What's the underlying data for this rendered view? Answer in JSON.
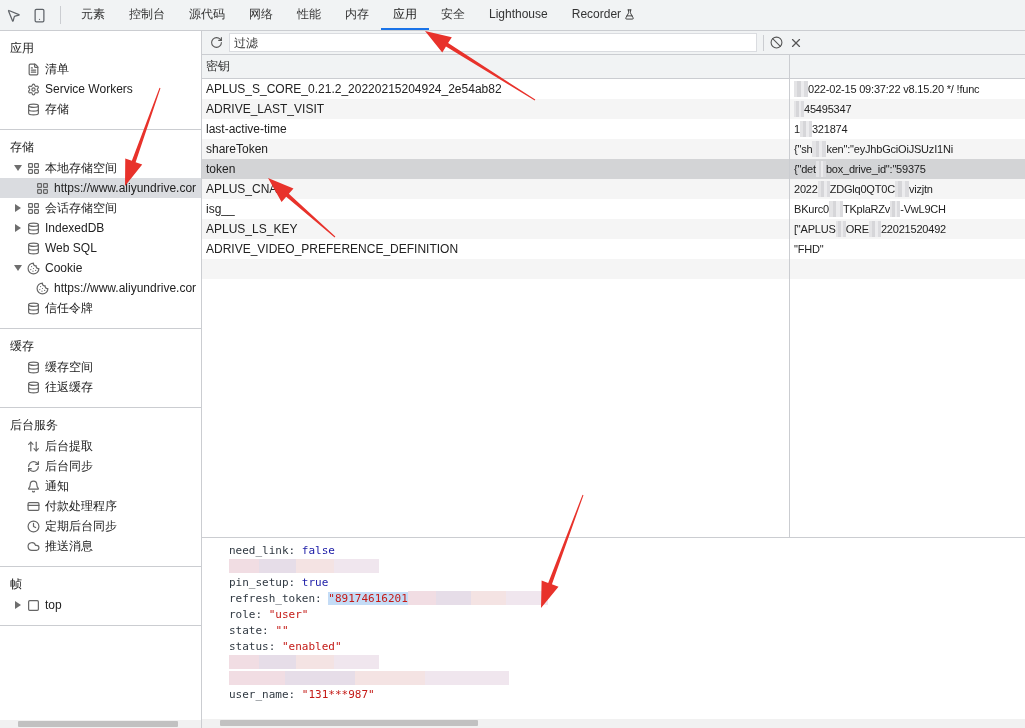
{
  "toolbar": {
    "tabs": [
      {
        "label": "元素",
        "selected": false
      },
      {
        "label": "控制台",
        "selected": false
      },
      {
        "label": "源代码",
        "selected": false
      },
      {
        "label": "网络",
        "selected": false
      },
      {
        "label": "性能",
        "selected": false
      },
      {
        "label": "内存",
        "selected": false
      },
      {
        "label": "应用",
        "selected": true
      },
      {
        "label": "安全",
        "selected": false
      },
      {
        "label": "Lighthouse",
        "selected": false
      },
      {
        "label": "Recorder",
        "selected": false,
        "kind": "experimental"
      }
    ]
  },
  "sidebar": {
    "sections": [
      {
        "title": "应用",
        "items": [
          {
            "kind": "file",
            "label": "清单"
          },
          {
            "kind": "gear",
            "label": "Service Workers"
          },
          {
            "kind": "database",
            "label": "存储"
          }
        ]
      },
      {
        "title": "存储",
        "items": [
          {
            "kind": "grid",
            "label": "本地存储空间",
            "expanded": true,
            "selected": false,
            "children": [
              {
                "kind": "grid",
                "label": "https://www.aliyundrive.cor",
                "selected": true
              }
            ]
          },
          {
            "kind": "grid",
            "label": "会话存储空间",
            "expanded": false,
            "selected": false
          },
          {
            "kind": "database",
            "label": "IndexedDB",
            "expanded": false,
            "selected": false
          },
          {
            "kind": "database",
            "label": "Web SQL"
          },
          {
            "kind": "cookie",
            "label": "Cookie",
            "expanded": true,
            "selected": false,
            "children": [
              {
                "kind": "cookie",
                "label": "https://www.aliyundrive.cor",
                "selected": false
              }
            ]
          },
          {
            "kind": "database",
            "label": "信任令牌"
          }
        ]
      },
      {
        "title": "缓存",
        "items": [
          {
            "kind": "database",
            "label": "缓存空间"
          },
          {
            "kind": "database",
            "label": "往返缓存"
          }
        ]
      },
      {
        "title": "后台服务",
        "items": [
          {
            "kind": "updown",
            "label": "后台提取"
          },
          {
            "kind": "sync",
            "label": "后台同步"
          },
          {
            "kind": "bell",
            "label": "通知"
          },
          {
            "kind": "card",
            "label": "付款处理程序"
          },
          {
            "kind": "clock",
            "label": "定期后台同步"
          },
          {
            "kind": "cloud",
            "label": "推送消息"
          }
        ]
      },
      {
        "title": "帧",
        "items": [
          {
            "kind": "frame",
            "label": "top",
            "expanded": false,
            "selected": false
          }
        ]
      }
    ]
  },
  "filter": {
    "placeholder": "过滤"
  },
  "table": {
    "columns": [
      "密钥"
    ],
    "rows": [
      {
        "key": "APLUS_S_CORE_0.21.2_20220215204924_2e54ab82",
        "selected": false,
        "value": [
          {
            "kind": "blur"
          },
          {
            "kind": "text",
            "text": "022-02-15 09:37:22 v8.15.20 */ !func"
          }
        ]
      },
      {
        "key": "ADRIVE_LAST_VISIT",
        "selected": false,
        "value": [
          {
            "kind": "blur"
          },
          {
            "kind": "text",
            "text": "45495347"
          }
        ]
      },
      {
        "key": "last-active-time",
        "selected": false,
        "value": [
          {
            "kind": "text",
            "text": "1"
          },
          {
            "kind": "blur"
          },
          {
            "kind": "text",
            "text": "321874"
          }
        ]
      },
      {
        "key": "shareToken",
        "selected": false,
        "value": [
          {
            "kind": "text",
            "text": "{\"sh"
          },
          {
            "kind": "blur"
          },
          {
            "kind": "text",
            "text": "ken\":\"eyJhbGciOiJSUzI1Ni"
          }
        ]
      },
      {
        "key": "token",
        "selected": true,
        "value": [
          {
            "kind": "text",
            "text": "{\"det"
          },
          {
            "kind": "blur"
          },
          {
            "kind": "text",
            "text": "box_drive_id\":\"59375"
          }
        ]
      },
      {
        "key": "APLUS_CNA",
        "selected": false,
        "value": [
          {
            "kind": "text",
            "text": "2022"
          },
          {
            "kind": "blur"
          },
          {
            "kind": "text",
            "text": "ZDGlq0QT0C"
          },
          {
            "kind": "blur"
          },
          {
            "kind": "text",
            "text": "vizjtn"
          }
        ]
      },
      {
        "key": "isg__",
        "selected": false,
        "value": [
          {
            "kind": "text",
            "text": "BKurc0"
          },
          {
            "kind": "blur"
          },
          {
            "kind": "text",
            "text": "TKplaRZv"
          },
          {
            "kind": "blur"
          },
          {
            "kind": "text",
            "text": "-VwL9CH"
          }
        ]
      },
      {
        "key": "APLUS_LS_KEY",
        "selected": false,
        "value": [
          {
            "kind": "text",
            "text": "[\"APLUS"
          },
          {
            "kind": "blur"
          },
          {
            "kind": "text",
            "text": "ORE"
          },
          {
            "kind": "blur"
          },
          {
            "kind": "text",
            "text": "22021520492"
          }
        ]
      },
      {
        "key": "ADRIVE_VIDEO_PREFERENCE_DEFINITION",
        "selected": false,
        "value": [
          {
            "kind": "text",
            "text": "\"FHD\""
          }
        ]
      }
    ]
  },
  "preview": {
    "lines": [
      {
        "kind": "field",
        "key": "need_link:",
        "value": "false",
        "string": false
      },
      {
        "kind": "blur"
      },
      {
        "kind": "field",
        "key": "pin_setup:",
        "value": "true",
        "string": false
      },
      {
        "kind": "field",
        "key": "refresh_token:",
        "value": "\"89174616201",
        "string": true,
        "highlighted": true,
        "blurred_tail": true
      },
      {
        "kind": "field",
        "key": "role:",
        "value": "\"user\"",
        "string": true
      },
      {
        "kind": "field",
        "key": "state:",
        "value": "\"\"",
        "string": true
      },
      {
        "kind": "field",
        "key": "status:",
        "value": "\"enabled\"",
        "string": true
      },
      {
        "kind": "blur"
      },
      {
        "kind": "blur"
      },
      {
        "kind": "field",
        "key": "user_name:",
        "value": "\"131***987\"",
        "string": true
      }
    ]
  }
}
